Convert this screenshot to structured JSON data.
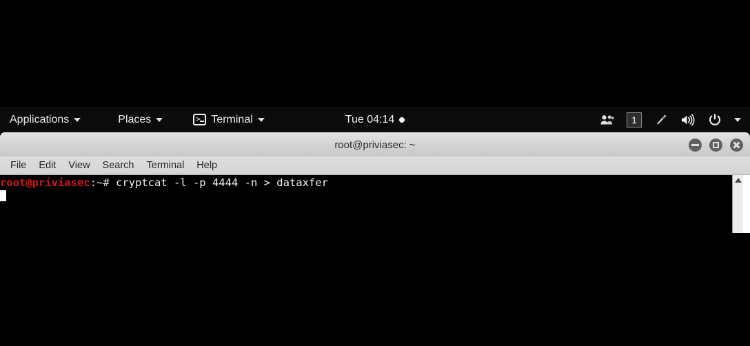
{
  "desktop": {
    "background_color": "#000000"
  },
  "top_panel": {
    "background_color": "#0b0b0b",
    "applications_label": "Applications",
    "places_label": "Places",
    "terminal_label": "Terminal",
    "terminal_icon": "terminal-icon",
    "clock": "Tue 04:14",
    "notification_dot": "",
    "tray": {
      "users_icon": "users-icon",
      "workspace_label": "1",
      "brush_icon": "brush-icon",
      "volume_icon": "volume-icon",
      "power_icon": "power-icon",
      "dropdown_icon": "chevron-down-icon"
    }
  },
  "terminal_window": {
    "title": "root@priviasec: ~",
    "controls": {
      "minimize": "minimize-button",
      "maximize": "maximize-button",
      "close": "close-button"
    },
    "menubar": [
      {
        "label": "File"
      },
      {
        "label": "Edit"
      },
      {
        "label": "View"
      },
      {
        "label": "Search"
      },
      {
        "label": "Terminal"
      },
      {
        "label": "Help"
      }
    ],
    "screen": {
      "background_color": "#000000",
      "prompt_user_color": "#d31616",
      "prompt_user": "root@priviasec",
      "prompt_path": ":~# ",
      "command": "cryptcat -l -p 4444 -n > dataxfer"
    }
  }
}
